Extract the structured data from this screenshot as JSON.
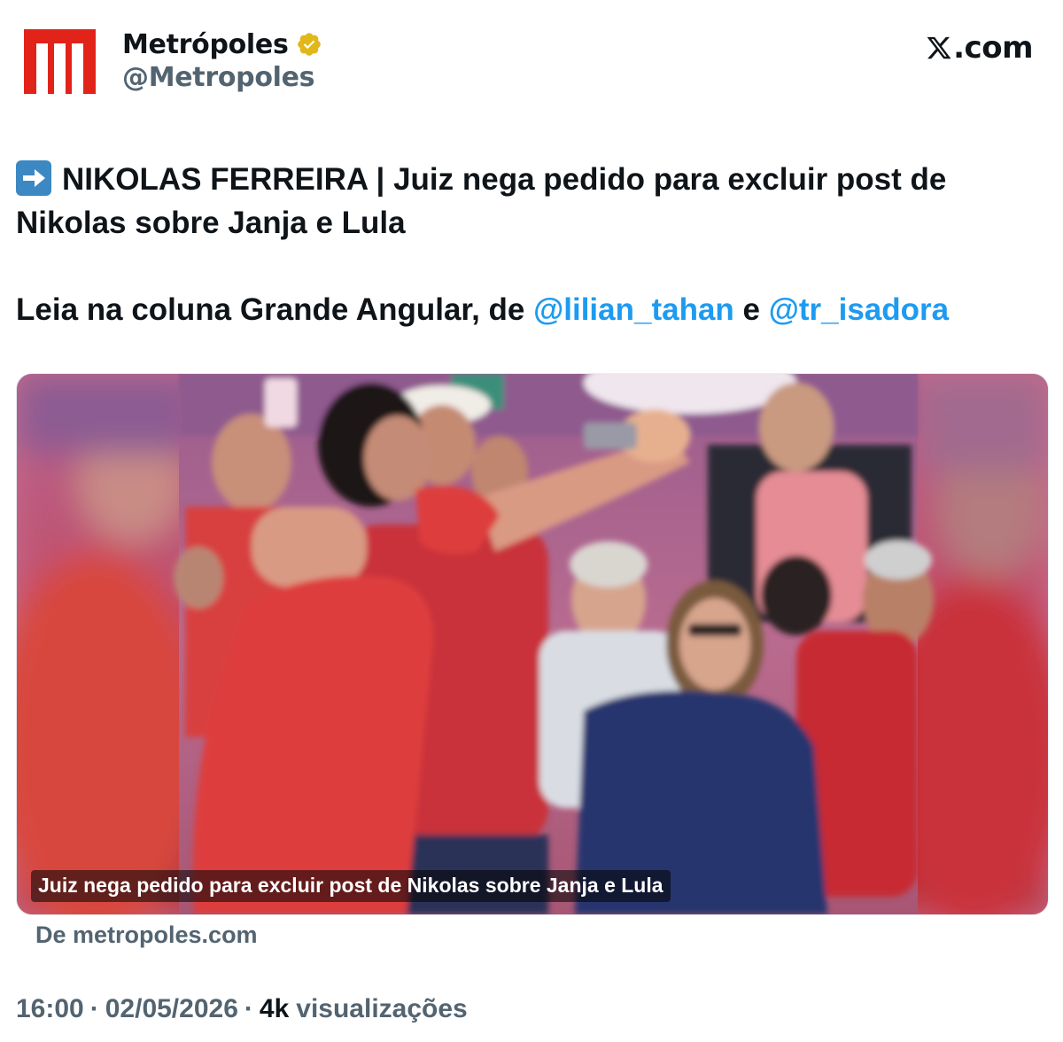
{
  "author": {
    "name": "Metrópoles",
    "handle": "@Metropoles",
    "verified": true
  },
  "site": {
    "label": ".com"
  },
  "tweet": {
    "headline": "NIKOLAS FERREIRA | Juiz nega pedido para excluir post de Nikolas sobre Janja e Lula",
    "line2_prefix": "Leia na coluna Grande Angular, de ",
    "mention1": "@lilian_tahan",
    "connector": " e ",
    "mention2": "@tr_isadora"
  },
  "media": {
    "caption": "Juiz nega pedido para excluir post de Nikolas sobre Janja e Lula"
  },
  "link_source": "De metropoles.com",
  "meta": {
    "time": "16:00",
    "date": "02/05/2026",
    "views_count": "4k",
    "views_label": "visualizações",
    "separator": "·"
  },
  "colors": {
    "brand_red": "#e2231a",
    "verified_gold": "#e2b719",
    "link_blue": "#1d9bf0",
    "secondary_text": "#536471"
  },
  "icons": {
    "logo": "metropoles-logo-icon",
    "verified": "verified-badge-icon",
    "x": "x-logo-icon",
    "arrow": "right-arrow-emoji-icon"
  }
}
